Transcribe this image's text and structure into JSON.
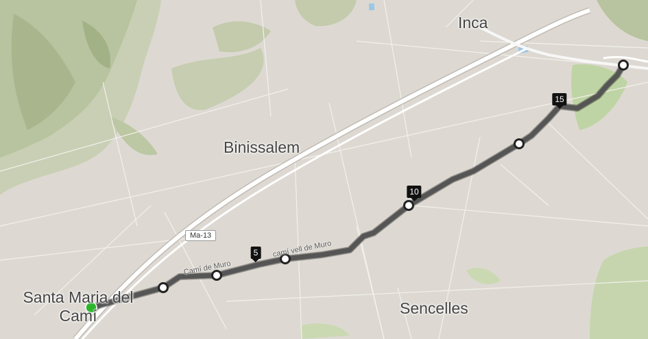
{
  "map": {
    "towns": [
      {
        "key": "inca",
        "name": "Inca"
      },
      {
        "key": "binissalem",
        "name": "Binissalem"
      },
      {
        "key": "santa_maria",
        "name": "Santa Maria del Camí"
      },
      {
        "key": "sencelles",
        "name": "Sencelles"
      }
    ],
    "roads": {
      "shield": "Ma-13",
      "street_1": "Camí de Muro",
      "street_2": "camí vell de Muro"
    },
    "route": {
      "km_markers": [
        "5",
        "10",
        "15"
      ],
      "color": "#555555",
      "start_color": "#2db52d"
    }
  }
}
